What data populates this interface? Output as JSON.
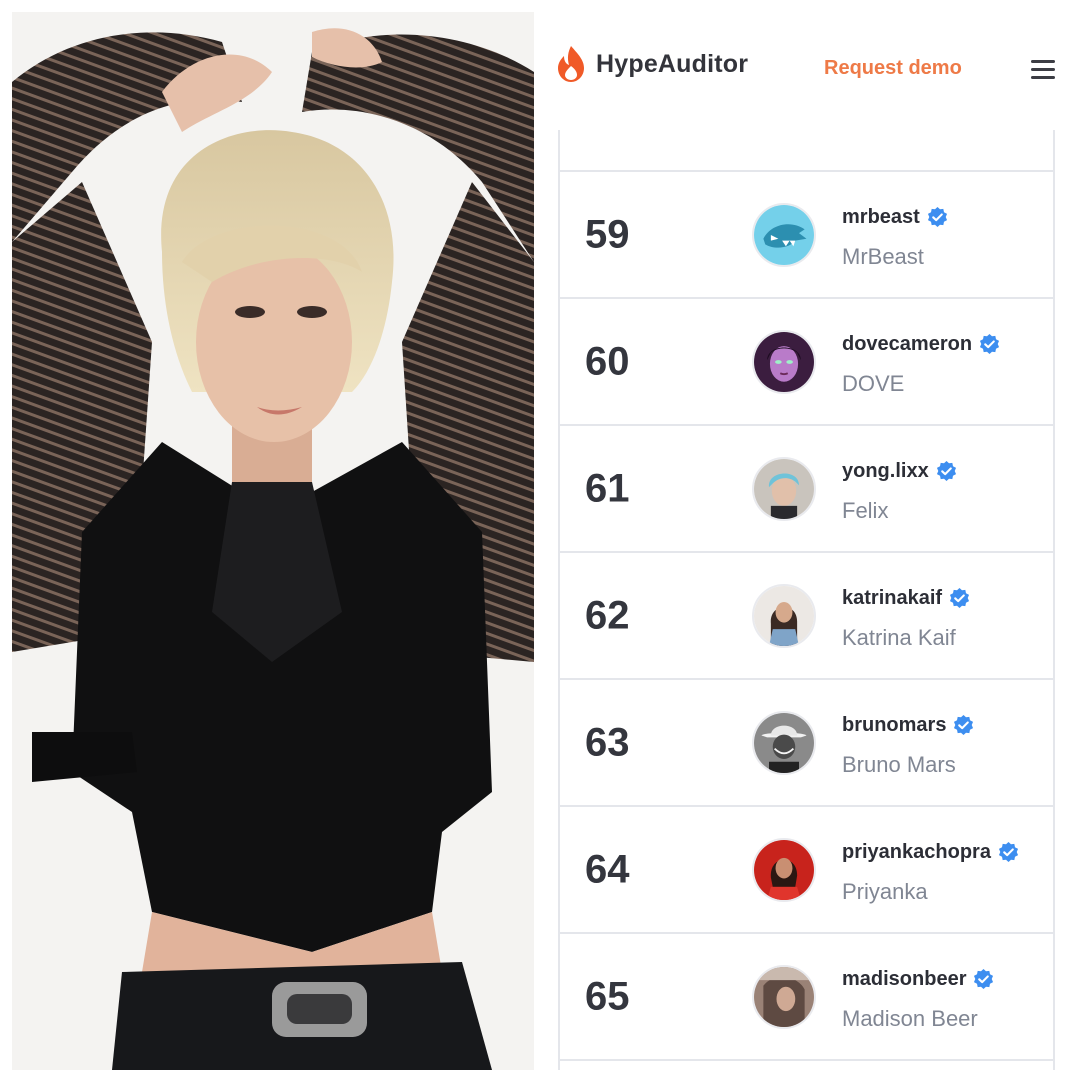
{
  "brand": {
    "name": "HypeAuditor",
    "logo_icon": "flame-icon",
    "accent": "#f05a28"
  },
  "header": {
    "request_demo_label": "Request demo",
    "menu_icon": "hamburger-menu-icon",
    "accent": "#ee7a47"
  },
  "ranking": {
    "rows": [
      {
        "rank": "59",
        "handle": "mrbeast",
        "name": "MrBeast",
        "verified": true
      },
      {
        "rank": "60",
        "handle": "dovecameron",
        "name": "DOVE",
        "verified": true
      },
      {
        "rank": "61",
        "handle": "yong.lixx",
        "name": "Felix",
        "verified": true
      },
      {
        "rank": "62",
        "handle": "katrinakaif",
        "name": "Katrina Kaif",
        "verified": true
      },
      {
        "rank": "63",
        "handle": "brunomars",
        "name": "Bruno Mars",
        "verified": true
      },
      {
        "rank": "64",
        "handle": "priyankachopra",
        "name": "Priyanka",
        "verified": true
      },
      {
        "rank": "65",
        "handle": "madisonbeer",
        "name": "Madison Beer",
        "verified": true
      }
    ]
  }
}
